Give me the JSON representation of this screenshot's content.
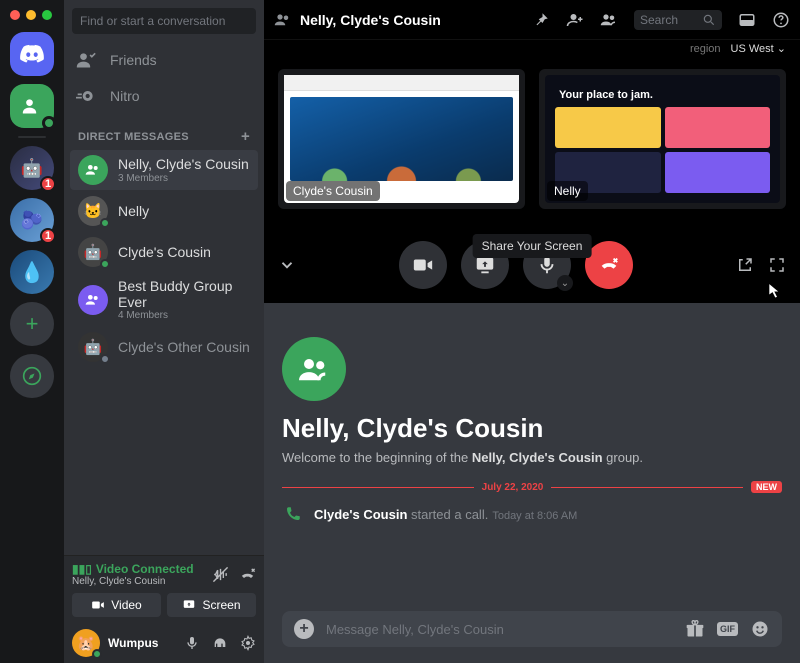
{
  "search_dm_placeholder": "Find or start a conversation",
  "nav": {
    "friends": "Friends",
    "nitro": "Nitro"
  },
  "dm_header": "DIRECT MESSAGES",
  "dms": [
    {
      "name": "Nelly, Clyde's Cousin",
      "sub": "3 Members",
      "avatar": "group",
      "active": true
    },
    {
      "name": "Nelly",
      "avatar": "nelly",
      "status": "online"
    },
    {
      "name": "Clyde's Cousin",
      "avatar": "clydec",
      "status": "online"
    },
    {
      "name": "Best Buddy Group Ever",
      "sub": "4 Members",
      "avatar": "group2"
    },
    {
      "name": "Clyde's Other Cousin",
      "avatar": "clydeo",
      "status": "offline",
      "faded": true
    }
  ],
  "voice": {
    "status": "Video Connected",
    "channel": "Nelly, Clyde's Cousin",
    "btn_video": "Video",
    "btn_screen": "Screen"
  },
  "user": {
    "name": "Wumpus"
  },
  "header": {
    "title": "Nelly, Clyde's Cousin",
    "search_placeholder": "Search",
    "region_label": "region",
    "region_value": "US West"
  },
  "call": {
    "tiles": [
      {
        "label": "Clyde's Cousin"
      },
      {
        "label": "Nelly"
      }
    ],
    "tooltip": "Share Your Screen",
    "jam_title": "Your place to jam."
  },
  "chat": {
    "title": "Nelly, Clyde's Cousin",
    "welcome_pre": "Welcome to the beginning of the ",
    "welcome_bold": "Nelly, Clyde's Cousin",
    "welcome_post": " group.",
    "date": "July 22, 2020",
    "new_badge": "NEW",
    "msg_user": "Clyde's Cousin",
    "msg_text": " started a call.",
    "msg_time": "Today at 8:06 AM",
    "composer_placeholder": "Message Nelly, Clyde's Cousin",
    "gif": "GIF"
  },
  "guild_badges": {
    "g1": "1",
    "g2": "1"
  }
}
